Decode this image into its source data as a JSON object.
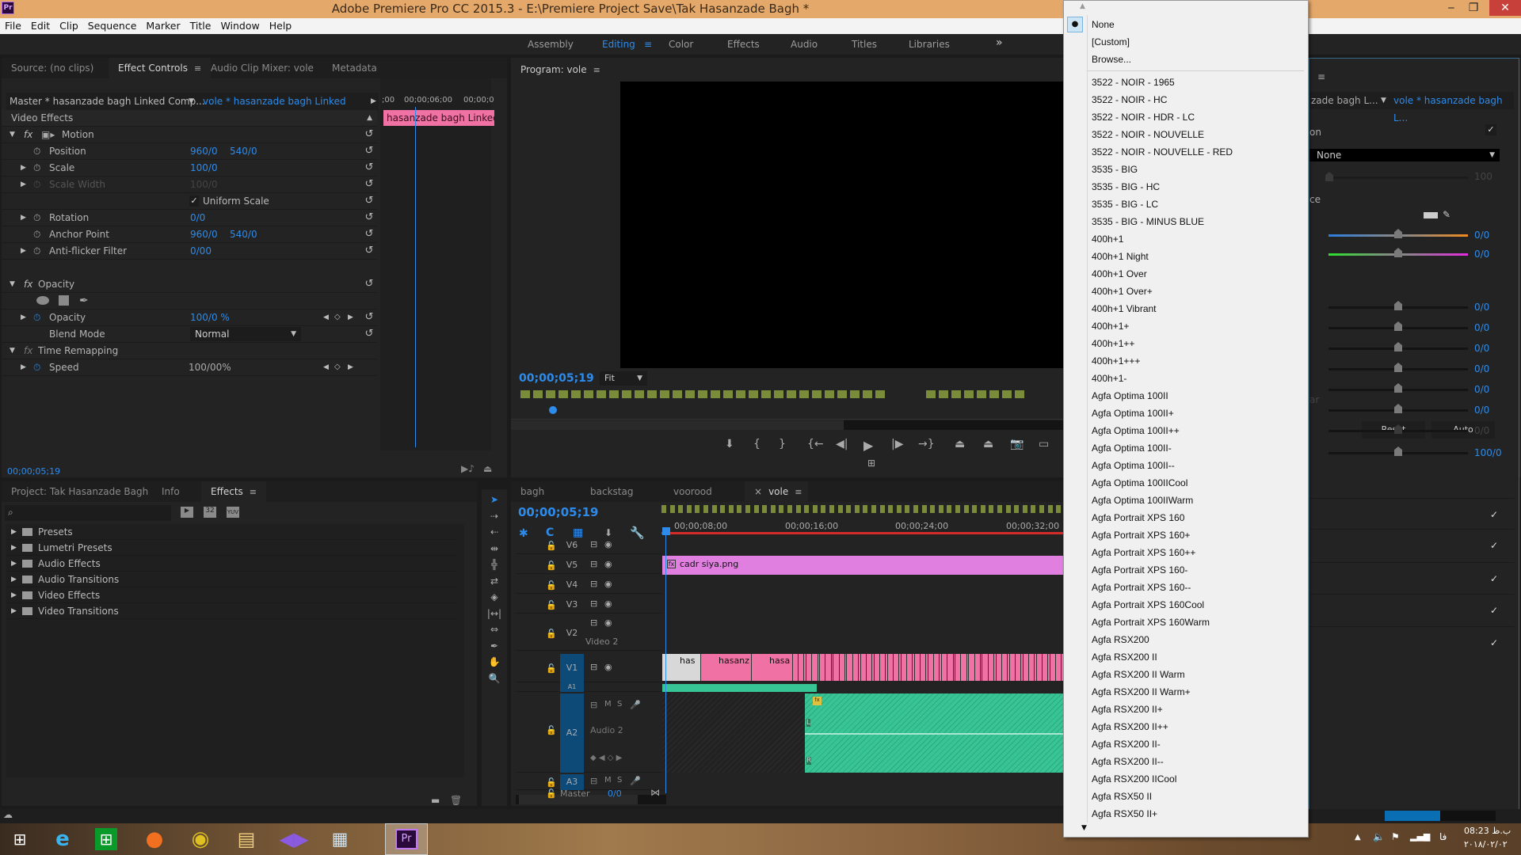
{
  "window": {
    "app_icon": "Pr",
    "title": "Adobe Premiere Pro CC 2015.3 - E:\\Premiere Project Save\\Tak Hasanzade Bagh *",
    "minimize": "‒",
    "maximize": "❐",
    "close": "✕"
  },
  "menu": [
    "File",
    "Edit",
    "Clip",
    "Sequence",
    "Marker",
    "Title",
    "Window",
    "Help"
  ],
  "workspaces": {
    "items": [
      "Assembly",
      "Editing",
      "Color",
      "Effects",
      "Audio",
      "Titles",
      "Libraries"
    ],
    "active": "Editing",
    "overflow": "»"
  },
  "effect_controls": {
    "tabs": [
      "Source: (no clips)",
      "Effect Controls",
      "Audio Clip Mixer: vole",
      "Metadata"
    ],
    "active_tab": "Effect Controls",
    "master_clip": "Master * hasanzade bagh Linked Comp...",
    "sequence_clip": "vole * hasanzade bagh Linked Comp...",
    "section": "Video Effects",
    "mini_timeline": {
      "ticks": [
        ";00",
        "00;00;06;00",
        "00;00;0"
      ],
      "clip_label": "hasanzade bagh Linked Co"
    },
    "motion": {
      "label": "Motion",
      "properties": [
        {
          "name": "Position",
          "v1": "960/0",
          "v2": "540/0",
          "expandable": false,
          "disabled": false
        },
        {
          "name": "Scale",
          "v1": "100/0",
          "v2": "",
          "expandable": true,
          "disabled": false
        },
        {
          "name": "Scale Width",
          "v1": "100/0",
          "v2": "",
          "expandable": true,
          "disabled": true
        },
        {
          "name": "Rotation",
          "v1": "0/0",
          "v2": "",
          "expandable": true,
          "disabled": false
        },
        {
          "name": "Anchor Point",
          "v1": "960/0",
          "v2": "540/0",
          "expandable": false,
          "disabled": false
        },
        {
          "name": "Anti-flicker Filter",
          "v1": "0/00",
          "v2": "",
          "expandable": true,
          "disabled": false
        }
      ],
      "uniform_scale_label": "Uniform Scale",
      "uniform_scale_checked": true
    },
    "opacity": {
      "label": "Opacity",
      "property": "Opacity",
      "value": "100/0 %",
      "blend_mode_label": "Blend Mode",
      "blend_mode_value": "Normal"
    },
    "time_remapping": {
      "label": "Time Remapping",
      "property": "Speed",
      "value": "100/00%"
    },
    "timecode": "00;00;05;19"
  },
  "program_monitor": {
    "title": "Program: vole",
    "timecode": "00;00;05;19",
    "zoom": "Fit"
  },
  "project_panel": {
    "tabs": [
      "Project: Tak Hasanzade Bagh",
      "Info",
      "Effects"
    ],
    "active_tab": "Effects",
    "search_placeholder": "",
    "filter_buttons": [
      "accelerated-effects",
      "32",
      "YUV"
    ],
    "folders": [
      {
        "name": "Presets",
        "starred": true
      },
      {
        "name": "Lumetri Presets",
        "starred": true
      },
      {
        "name": "Audio Effects",
        "starred": false
      },
      {
        "name": "Audio Transitions",
        "starred": false
      },
      {
        "name": "Video Effects",
        "starred": false
      },
      {
        "name": "Video Transitions",
        "starred": false
      }
    ]
  },
  "timeline": {
    "tabs": [
      "bagh",
      "backstag",
      "voorood",
      "vole"
    ],
    "active_tab": "vole",
    "timecode": "00;00;05;19",
    "ruler": [
      "00;00;08;00",
      "00;00;16;00",
      "00;00;24;00",
      "00;00;32;00"
    ],
    "video_tracks": [
      {
        "id": "V6",
        "name": ""
      },
      {
        "id": "V5",
        "name": ""
      },
      {
        "id": "V4",
        "name": ""
      },
      {
        "id": "V3",
        "name": ""
      },
      {
        "id": "V2",
        "name": "Video 2"
      },
      {
        "id": "V1",
        "name": ""
      }
    ],
    "audio_tracks": [
      {
        "id": "A1",
        "name": ""
      },
      {
        "id": "A2",
        "name": "Audio 2"
      },
      {
        "id": "A3",
        "name": ""
      }
    ],
    "master_label": "Master",
    "master_value": "0/0",
    "clips": {
      "v5": "cadr siya.png",
      "v1": [
        "has",
        "hasanz",
        "hasa"
      ]
    },
    "audio_channel_labels": [
      "L",
      "R"
    ],
    "mute": "M",
    "solo": "S"
  },
  "lumetri": {
    "sequence_clip": "vole * hasanzade bagh L...",
    "master_clip_partial": "zade bagh L...",
    "section_partial": "on",
    "look_value": "None",
    "intensity_value": "100",
    "wb_partial": "ce",
    "temperature_value": "0/0",
    "tint_value": "0/0",
    "tone_values": [
      "0/0",
      "0/0",
      "0/0",
      "0/0",
      "0/0",
      "0/0",
      "0/0"
    ],
    "reset_label": "Reset",
    "auto_label": "Auto",
    "saturation_value": "100/0"
  },
  "lut_dropdown": {
    "selected": "None",
    "items_top": [
      "None",
      "[Custom]",
      "Browse..."
    ],
    "items": [
      "3522 - NOIR - 1965",
      "3522 - NOIR - HC",
      "3522 - NOIR - HDR - LC",
      "3522 - NOIR - NOUVELLE",
      "3522 - NOIR - NOUVELLE - RED",
      "3535 - BIG",
      "3535 - BIG - HC",
      "3535 - BIG - LC",
      "3535 - BIG - MINUS BLUE",
      "400h+1",
      "400h+1 Night",
      "400h+1 Over",
      "400h+1 Over+",
      "400h+1 Vibrant",
      "400h+1+",
      "400h+1++",
      "400h+1+++",
      "400h+1-",
      "Agfa Optima 100II",
      "Agfa Optima 100II+",
      "Agfa Optima 100II++",
      "Agfa Optima 100II-",
      "Agfa Optima 100II--",
      "Agfa Optima 100IICool",
      "Agfa Optima 100IIWarm",
      "Agfa Portrait XPS 160",
      "Agfa Portrait XPS 160+",
      "Agfa Portrait XPS 160++",
      "Agfa Portrait XPS 160-",
      "Agfa Portrait XPS 160--",
      "Agfa Portrait XPS 160Cool",
      "Agfa Portrait XPS 160Warm",
      "Agfa RSX200",
      "Agfa RSX200 II",
      "Agfa RSX200 II Warm",
      "Agfa RSX200 II Warm+",
      "Agfa RSX200 II+",
      "Agfa RSX200 II++",
      "Agfa RSX200 II-",
      "Agfa RSX200 II--",
      "Agfa RSX200 IICool",
      "Agfa RSX50 II",
      "Agfa RSX50 II+"
    ]
  },
  "status": {
    "progress_fraction": 0.5
  },
  "taskbar": {
    "apps": [
      "start",
      "internet-explorer",
      "store",
      "firefox",
      "chrome",
      "file-explorer",
      "visual-studio",
      "calculator",
      "premiere-pro"
    ],
    "premiere_label": "Pr",
    "clock_time": "08:23 ب.ظ",
    "clock_date": "۲۰۱۸/۰۲/۰۲",
    "language": "فا"
  }
}
